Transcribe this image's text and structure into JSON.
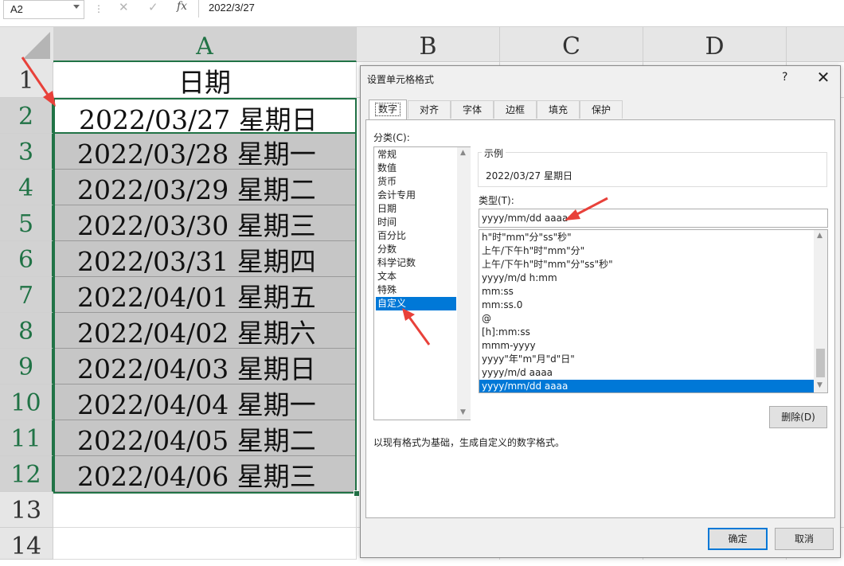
{
  "formula_bar": {
    "name_box": "A2",
    "separator": "⋮",
    "cancel_icon": "✕",
    "enter_icon": "✓",
    "fx": "fx",
    "formula": "2022/3/27"
  },
  "sheet": {
    "columns": [
      "A",
      "B",
      "C",
      "D"
    ],
    "rows": [
      "1",
      "2",
      "3",
      "4",
      "5",
      "6",
      "7",
      "8",
      "9",
      "10",
      "11",
      "12",
      "13",
      "14"
    ],
    "header_cell": "日期",
    "cells": [
      "2022/03/27  星期日",
      "2022/03/28  星期一",
      "2022/03/29  星期二",
      "2022/03/30  星期三",
      "2022/03/31  星期四",
      "2022/04/01  星期五",
      "2022/04/02  星期六",
      "2022/04/03  星期日",
      "2022/04/04  星期一",
      "2022/04/05  星期二",
      "2022/04/06  星期三"
    ],
    "selection_color": "#217346",
    "highlight_color": "#c6c6c6"
  },
  "dialog": {
    "title": "设置单元格格式",
    "help": "?",
    "close": "✕",
    "tabs": [
      "数字",
      "对齐",
      "字体",
      "边框",
      "填充",
      "保护"
    ],
    "category_label": "分类(C):",
    "categories": [
      "常规",
      "数值",
      "货币",
      "会计专用",
      "日期",
      "时间",
      "百分比",
      "分数",
      "科学记数",
      "文本",
      "特殊",
      "自定义"
    ],
    "selected_category": "自定义",
    "sample_label": "示例",
    "sample_value": "2022/03/27 星期日",
    "type_label": "类型(T):",
    "type_value": "yyyy/mm/dd aaaa",
    "type_list": [
      "h\"时\"mm\"分\"ss\"秒\"",
      "上午/下午h\"时\"mm\"分\"",
      "上午/下午h\"时\"mm\"分\"ss\"秒\"",
      "yyyy/m/d h:mm",
      "mm:ss",
      "mm:ss.0",
      "@",
      "[h]:mm:ss",
      "mmm-yyyy",
      "yyyy\"年\"m\"月\"d\"日\"",
      "yyyy/m/d aaaa",
      "yyyy/mm/dd aaaa"
    ],
    "selected_type": "yyyy/mm/dd aaaa",
    "delete_button": "删除(D)",
    "description": "以现有格式为基础，生成自定义的数字格式。",
    "ok_button": "确定",
    "cancel_button": "取消",
    "accent_color": "#0078d7"
  },
  "annotations": {
    "arrow_color": "#e8413a"
  }
}
